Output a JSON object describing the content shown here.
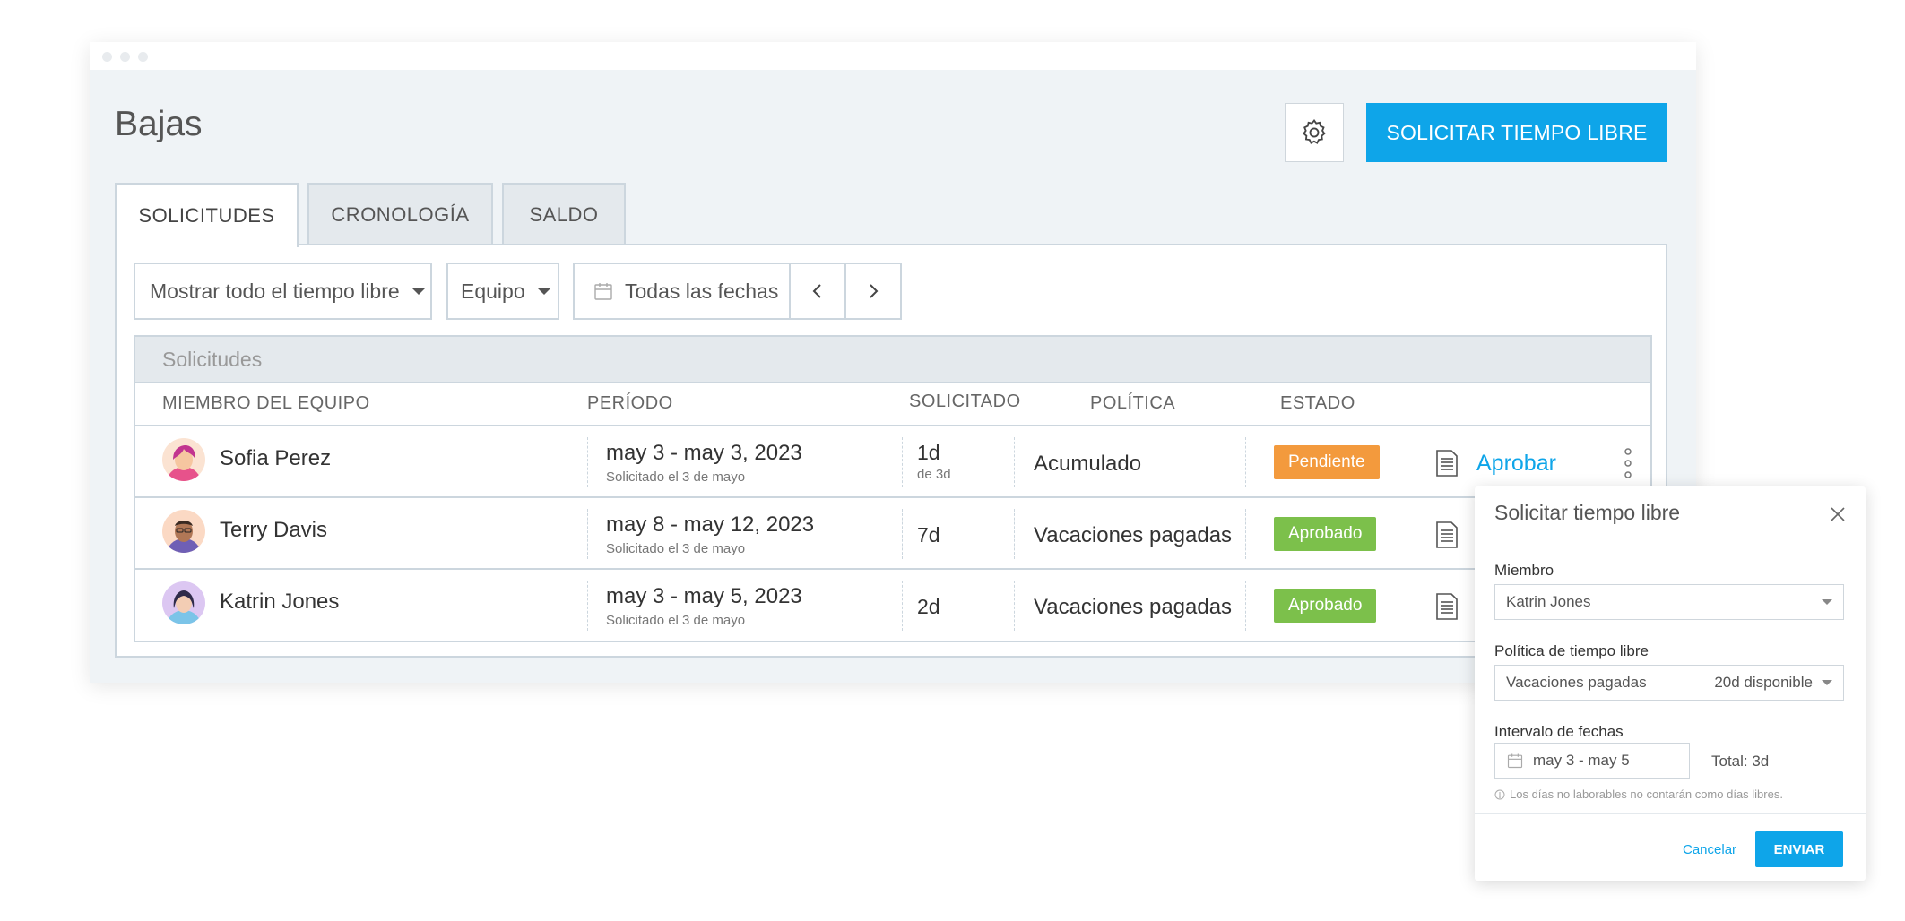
{
  "header": {
    "title": "Bajas",
    "primary_button": "SOLICITAR TIEMPO LIBRE"
  },
  "tabs": [
    {
      "label": "SOLICITUDES",
      "active": true
    },
    {
      "label": "CRONOLOGÍA",
      "active": false
    },
    {
      "label": "SALDO",
      "active": false
    }
  ],
  "filters": {
    "type": "Mostrar todo el tiempo libre",
    "group": "Equipo",
    "dates": "Todas las fechas"
  },
  "table": {
    "title": "Solicitudes",
    "columns": {
      "member": "MIEMBRO DEL EQUIPO",
      "period": "PERÍODO",
      "requested": "SOLICITADO",
      "policy": "POLÍTICA",
      "status": "ESTADO"
    },
    "rows": [
      {
        "name": "Sofia Perez",
        "period": "may 3 - may 3, 2023",
        "requested_on": "Solicitado el 3 de mayo",
        "amount": "1d",
        "amount_sub": "de 3d",
        "policy": "Acumulado",
        "status": "Pendiente",
        "status_color": "#f39a3d",
        "action": "Aprobar"
      },
      {
        "name": "Terry Davis",
        "period": "may 8 - may 12, 2023",
        "requested_on": "Solicitado el 3 de mayo",
        "amount": "7d",
        "policy": "Vacaciones pagadas",
        "status": "Aprobado",
        "status_color": "#7cc04b"
      },
      {
        "name": "Katrin Jones",
        "period": "may 3 - may 5, 2023",
        "requested_on": "Solicitado el 3 de mayo",
        "amount": "2d",
        "policy": "Vacaciones pagadas",
        "status": "Aprobado",
        "status_color": "#7cc04b"
      }
    ]
  },
  "popup": {
    "title": "Solicitar tiempo libre",
    "member_label": "Miembro",
    "member_value": "Katrin Jones",
    "policy_label": "Política de tiempo libre",
    "policy_value": "Vacaciones pagadas",
    "policy_available": "20d disponible",
    "range_label": "Intervalo de fechas",
    "range_value": "may 3 - may 5",
    "total": "Total: 3d",
    "note": "Los días no laborables no contarán como días libres.",
    "cancel": "Cancelar",
    "submit": "ENVIAR"
  },
  "colors": {
    "accent": "#0ea5e9",
    "pending": "#f39a3d",
    "approved": "#7cc04b"
  }
}
